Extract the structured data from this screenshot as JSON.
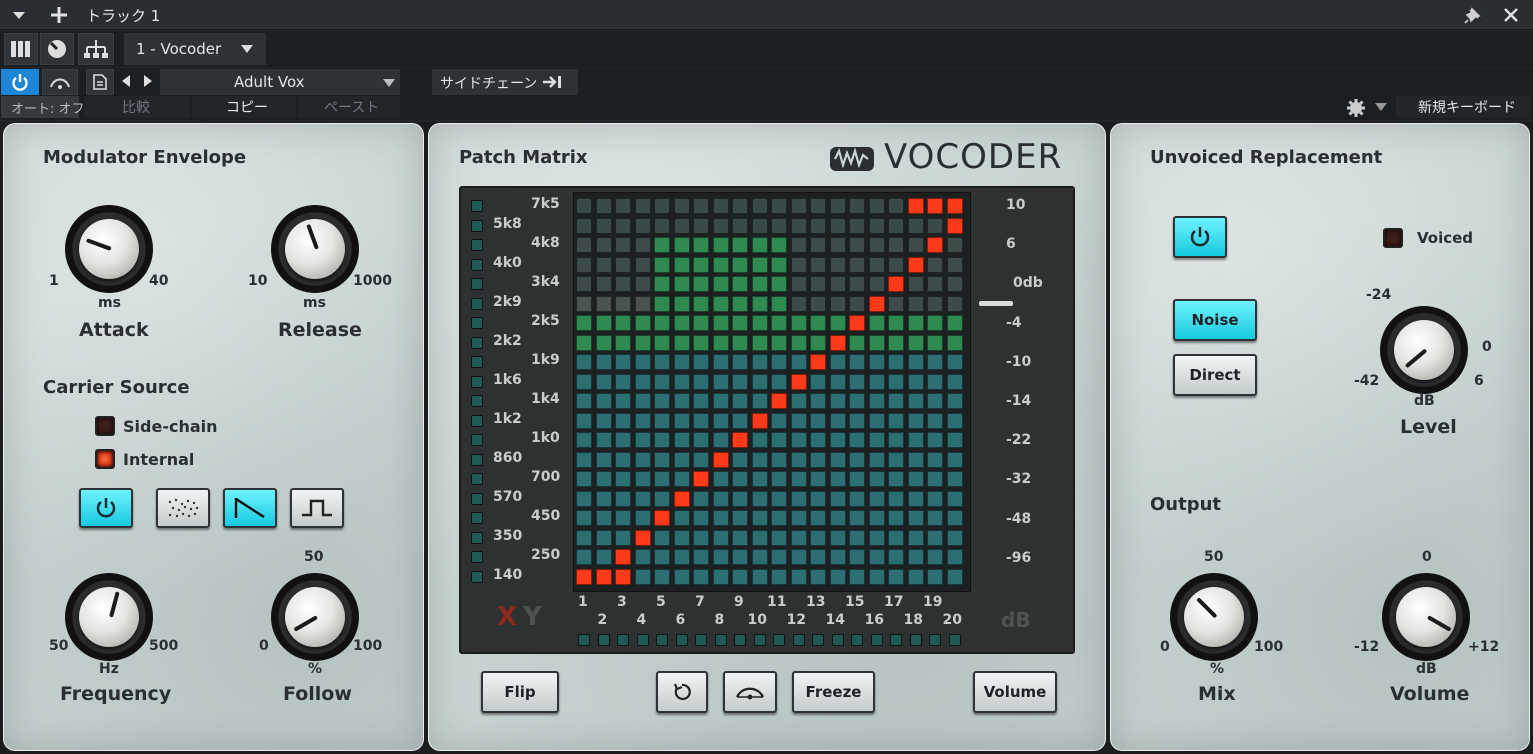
{
  "host": {
    "track_title": "トラック 1",
    "device_name": "1 - Vocoder",
    "preset_name": "Adult Vox",
    "sidechain_label": "サイドチェーン",
    "auto_label": "オート: オフ",
    "compare_label": "比較",
    "copy_label": "コピー",
    "paste_label": "ペースト",
    "keyboard_label": "新規キーボード"
  },
  "left": {
    "modulator_title": "Modulator Envelope",
    "attack": {
      "min": "1",
      "max": "40",
      "unit": "ms",
      "label": "Attack"
    },
    "release": {
      "min": "10",
      "max": "1000",
      "unit": "ms",
      "label": "Release"
    },
    "carrier_title": "Carrier Source",
    "sidechain": "Side-chain",
    "internal": "Internal",
    "frequency": {
      "min": "50",
      "max": "500",
      "unit": "Hz",
      "label": "Frequency"
    },
    "follow": {
      "min": "0",
      "max": "100",
      "top": "50",
      "unit": "%",
      "label": "Follow"
    }
  },
  "center": {
    "title": "Patch Matrix",
    "brand": "VOCODER",
    "left_freqs_a": [
      "7k5",
      "4k8",
      "3k4",
      "2k5",
      "1k9",
      "1k4",
      "1k0",
      "700",
      "450",
      "250"
    ],
    "left_freqs_b": [
      "5k8",
      "4k0",
      "2k9",
      "2k2",
      "1k6",
      "1k2",
      "860",
      "570",
      "350",
      "140"
    ],
    "db_labels": [
      "10",
      "6",
      "0db",
      "-4",
      "-10",
      "-14",
      "-22",
      "-32",
      "-48",
      "-96"
    ],
    "x_letter": "X",
    "y_letter": "Y",
    "db_unit": "dB",
    "bands_odd": [
      "1",
      "3",
      "5",
      "7",
      "9",
      "11",
      "13",
      "15",
      "17",
      "19"
    ],
    "bands_even": [
      "2",
      "4",
      "6",
      "8",
      "10",
      "12",
      "14",
      "16",
      "18",
      "20"
    ],
    "flip_label": "Flip",
    "freeze_label": "Freeze",
    "volume_label": "Volume"
  },
  "right": {
    "unvoiced_title": "Unvoiced Replacement",
    "voiced_label": "Voiced",
    "noise_label": "Noise",
    "direct_label": "Direct",
    "level": {
      "top": "-24",
      "right": "0",
      "min": "-42",
      "max": "6",
      "unit": "dB",
      "label": "Level"
    },
    "output_title": "Output",
    "mix": {
      "top": "50",
      "min": "0",
      "max": "100",
      "unit": "%",
      "label": "Mix"
    },
    "volume": {
      "top": "0",
      "min": "-12",
      "max": "+12",
      "unit": "dB",
      "label": "Volume"
    }
  },
  "colors": {
    "accent_on": "#16c9df",
    "matrix_active": "#ff3a1a",
    "matrix_teal": "#2b6f73",
    "matrix_green": "#2f8a52"
  }
}
